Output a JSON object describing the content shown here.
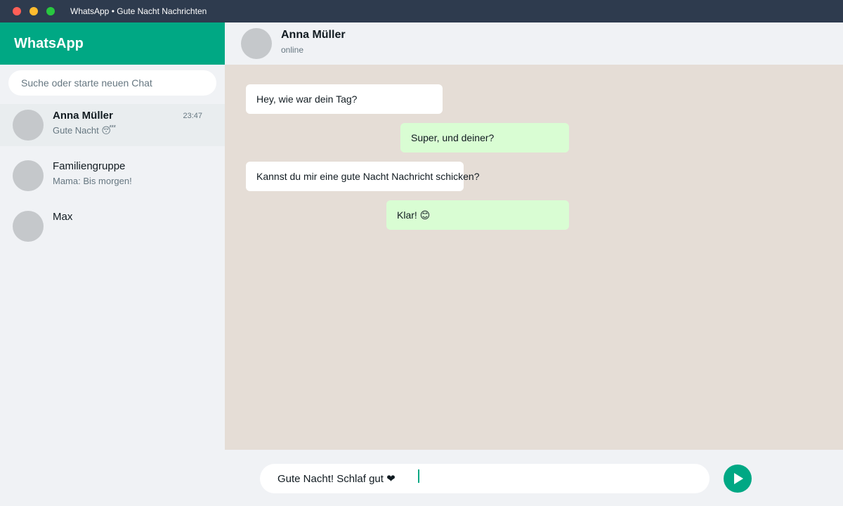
{
  "window": {
    "title": "WhatsApp • Gute Nacht Nachrichten"
  },
  "sidebar": {
    "brand": "WhatsApp",
    "search_placeholder": "Suche oder starte neuen Chat",
    "chats": [
      {
        "name": "Anna Müller",
        "time": "23:47",
        "preview": "Gute Nacht 😴"
      },
      {
        "name": "Familiengruppe",
        "preview": "Mama: Bis morgen!"
      },
      {
        "name": "Max"
      }
    ]
  },
  "chat": {
    "contact_name": "Anna Müller",
    "contact_status": "online",
    "messages": [
      {
        "text": "Hey, wie war dein Tag?",
        "direction": "incoming"
      },
      {
        "text": "Super, und deiner?",
        "direction": "outgoing"
      },
      {
        "text": "Kannst du mir eine gute Nacht Nachricht schicken?",
        "direction": "incoming"
      },
      {
        "text": "Klar! 😊",
        "direction": "outgoing"
      }
    ]
  },
  "composer": {
    "draft": "Gute Nacht! Schlaf gut ❤"
  },
  "colors": {
    "accent": "#00a884",
    "titlebar": "#2e3b4e",
    "incoming_bubble": "#ffffff",
    "outgoing_bubble": "#d9fdd3",
    "chat_background": "#e5ddd6"
  },
  "icons": {
    "send": "send-icon"
  }
}
